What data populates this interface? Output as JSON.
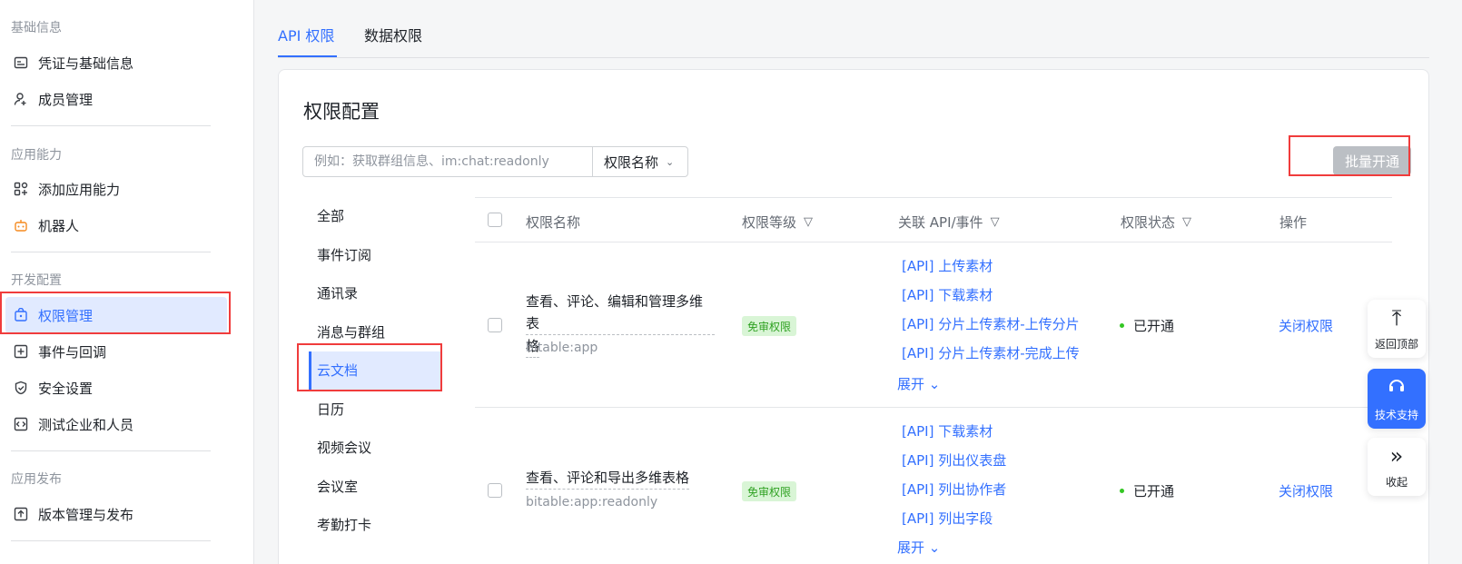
{
  "sidebar": {
    "sections": [
      {
        "label": "基础信息"
      },
      {
        "label": "应用能力"
      },
      {
        "label": "开发配置"
      },
      {
        "label": "应用发布"
      }
    ],
    "items": [
      {
        "label": "凭证与基础信息",
        "icon": "credential-icon"
      },
      {
        "label": "成员管理",
        "icon": "add-member-icon"
      },
      {
        "label": "添加应用能力",
        "icon": "add-capability-icon"
      },
      {
        "label": "机器人",
        "icon": "robot-icon"
      },
      {
        "label": "权限管理",
        "icon": "permission-icon"
      },
      {
        "label": "事件与回调",
        "icon": "event-icon"
      },
      {
        "label": "安全设置",
        "icon": "shield-icon"
      },
      {
        "label": "测试企业和人员",
        "icon": "test-icon"
      },
      {
        "label": "版本管理与发布",
        "icon": "upload-icon"
      }
    ]
  },
  "tabs": [
    {
      "label": "API 权限"
    },
    {
      "label": "数据权限"
    }
  ],
  "card": {
    "title": "权限配置",
    "search_placeholder": "例如：获取群组信息、im:chat:readonly",
    "search_type": "权限名称",
    "batch_button": "批量开通"
  },
  "categories": [
    {
      "label": "全部"
    },
    {
      "label": "事件订阅"
    },
    {
      "label": "通讯录"
    },
    {
      "label": "消息与群组"
    },
    {
      "label": "云文档"
    },
    {
      "label": "日历"
    },
    {
      "label": "视频会议"
    },
    {
      "label": "会议室"
    },
    {
      "label": "考勤打卡"
    }
  ],
  "table": {
    "headers": {
      "name": "权限名称",
      "level": "权限等级",
      "api": "关联 API/事件",
      "status": "权限状态",
      "action": "操作"
    },
    "rows": [
      {
        "name_line1": "查看、评论、编辑和管理多维表",
        "name_line2": "格",
        "code": "bitable:app",
        "level": "免审权限",
        "apis": [
          "[API] 上传素材",
          "[API] 下载素材",
          "[API] 分片上传素材-上传分片",
          "[API] 分片上传素材-完成上传"
        ],
        "expand": "展开",
        "status": "已开通",
        "action": "关闭权限"
      },
      {
        "name_line1": "查看、评论和导出多维表格",
        "code": "bitable:app:readonly",
        "level": "免审权限",
        "apis": [
          "[API] 下载素材",
          "[API] 列出仪表盘",
          "[API] 列出协作者",
          "[API] 列出字段"
        ],
        "expand": "展开",
        "status": "已开通",
        "action": "关闭权限"
      }
    ]
  },
  "floating": {
    "back_top": "返回顶部",
    "support": "技术支持",
    "collapse": "收起"
  },
  "colors": {
    "accent": "#3370ff",
    "highlight_box": "#f03c3c",
    "badge_bg": "#d9f5d6",
    "badge_text": "#2ea121",
    "status_dot": "#34c724"
  }
}
